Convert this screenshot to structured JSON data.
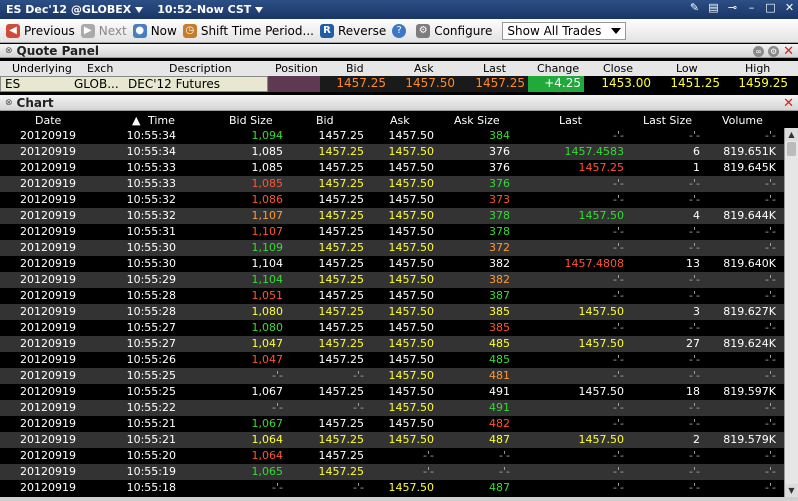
{
  "window": {
    "title_contract": "ES Dec'12 @GLOBEX",
    "title_time": "10:52-Now CST"
  },
  "toolbar": {
    "previous": "Previous",
    "next": "Next",
    "now": "Now",
    "shift": "Shift Time Period...",
    "reverse": "Reverse",
    "configure": "Configure",
    "filter_value": "Show All Trades"
  },
  "quote_panel": {
    "title": "Quote Panel",
    "headers": {
      "underlying": "Underlying",
      "exch": "Exch",
      "description": "Description",
      "position": "Position",
      "bid": "Bid",
      "ask": "Ask",
      "last": "Last",
      "change": "Change",
      "close": "Close",
      "low": "Low",
      "high": "High"
    },
    "row": {
      "underlying": "ES",
      "exch": "GLOB...",
      "description": "DEC'12 Futures",
      "position": "",
      "bid": "1457.25",
      "ask": "1457.50",
      "last": "1457.25",
      "change": "+4.25",
      "close": "1453.00",
      "low": "1451.25",
      "high": "1459.25"
    },
    "colors": {
      "change_bg": "#1faa3a",
      "position_bg": "#5e3a52",
      "value": "#ff8a22",
      "close_low_high": "#ffff33"
    }
  },
  "chart": {
    "title": "Chart",
    "headers": {
      "date": "Date",
      "time": "Time",
      "bid_size": "Bid Size",
      "bid": "Bid",
      "ask": "Ask",
      "ask_size": "Ask Size",
      "last": "Last",
      "last_size": "Last Size",
      "volume": "Volume"
    },
    "rows": [
      {
        "date": "20120919",
        "time": "10:55:34",
        "bid_size": "1,094",
        "bsc": "gn",
        "bid": "1457.25",
        "bidc": "wh",
        "ask": "1457.50",
        "askc": "wh",
        "ask_size": "384",
        "asc": "gn",
        "last": "-'-",
        "lc": "gy",
        "last_size": "-'-",
        "volume": "-'-"
      },
      {
        "date": "20120919",
        "time": "10:55:34",
        "bid_size": "1,085",
        "bsc": "wh",
        "bid": "1457.25",
        "bidc": "yl",
        "ask": "1457.50",
        "askc": "yl",
        "ask_size": "376",
        "asc": "wh",
        "last": "1457.4583",
        "lc": "gn",
        "last_size": "6",
        "volume": "819.651K"
      },
      {
        "date": "20120919",
        "time": "10:55:33",
        "bid_size": "1,085",
        "bsc": "wh",
        "bid": "1457.25",
        "bidc": "wh",
        "ask": "1457.50",
        "askc": "wh",
        "ask_size": "376",
        "asc": "wh",
        "last": "1457.25",
        "lc": "rd",
        "last_size": "1",
        "volume": "819.645K"
      },
      {
        "date": "20120919",
        "time": "10:55:33",
        "bid_size": "1,085",
        "bsc": "rd",
        "bid": "1457.25",
        "bidc": "yl",
        "ask": "1457.50",
        "askc": "yl",
        "ask_size": "376",
        "asc": "gn",
        "last": "-'-",
        "lc": "gy",
        "last_size": "-'-",
        "volume": "-'-"
      },
      {
        "date": "20120919",
        "time": "10:55:32",
        "bid_size": "1,086",
        "bsc": "rd",
        "bid": "1457.25",
        "bidc": "wh",
        "ask": "1457.50",
        "askc": "wh",
        "ask_size": "373",
        "asc": "rd",
        "last": "-'-",
        "lc": "gy",
        "last_size": "-'-",
        "volume": "-'-"
      },
      {
        "date": "20120919",
        "time": "10:55:32",
        "bid_size": "1,107",
        "bsc": "or",
        "bid": "1457.25",
        "bidc": "yl",
        "ask": "1457.50",
        "askc": "yl",
        "ask_size": "378",
        "asc": "gn",
        "last": "1457.50",
        "lc": "gn",
        "last_size": "4",
        "volume": "819.644K"
      },
      {
        "date": "20120919",
        "time": "10:55:31",
        "bid_size": "1,107",
        "bsc": "rd",
        "bid": "1457.25",
        "bidc": "wh",
        "ask": "1457.50",
        "askc": "wh",
        "ask_size": "378",
        "asc": "gn",
        "last": "-'-",
        "lc": "gy",
        "last_size": "-'-",
        "volume": "-'-"
      },
      {
        "date": "20120919",
        "time": "10:55:30",
        "bid_size": "1,109",
        "bsc": "gn",
        "bid": "1457.25",
        "bidc": "yl",
        "ask": "1457.50",
        "askc": "yl",
        "ask_size": "372",
        "asc": "or",
        "last": "-'-",
        "lc": "gy",
        "last_size": "-'-",
        "volume": "-'-"
      },
      {
        "date": "20120919",
        "time": "10:55:30",
        "bid_size": "1,104",
        "bsc": "wh",
        "bid": "1457.25",
        "bidc": "wh",
        "ask": "1457.50",
        "askc": "wh",
        "ask_size": "382",
        "asc": "wh",
        "last": "1457.4808",
        "lc": "rd",
        "last_size": "13",
        "volume": "819.640K"
      },
      {
        "date": "20120919",
        "time": "10:55:29",
        "bid_size": "1,104",
        "bsc": "gn",
        "bid": "1457.25",
        "bidc": "yl",
        "ask": "1457.50",
        "askc": "yl",
        "ask_size": "382",
        "asc": "or",
        "last": "-'-",
        "lc": "gy",
        "last_size": "-'-",
        "volume": "-'-"
      },
      {
        "date": "20120919",
        "time": "10:55:28",
        "bid_size": "1,051",
        "bsc": "rd",
        "bid": "1457.25",
        "bidc": "wh",
        "ask": "1457.50",
        "askc": "wh",
        "ask_size": "387",
        "asc": "gn",
        "last": "-'-",
        "lc": "gy",
        "last_size": "-'-",
        "volume": "-'-"
      },
      {
        "date": "20120919",
        "time": "10:55:28",
        "bid_size": "1,080",
        "bsc": "yl",
        "bid": "1457.25",
        "bidc": "yl",
        "ask": "1457.50",
        "askc": "yl",
        "ask_size": "385",
        "asc": "yl",
        "last": "1457.50",
        "lc": "yl",
        "last_size": "3",
        "volume": "819.627K"
      },
      {
        "date": "20120919",
        "time": "10:55:27",
        "bid_size": "1,080",
        "bsc": "gn",
        "bid": "1457.25",
        "bidc": "wh",
        "ask": "1457.50",
        "askc": "wh",
        "ask_size": "385",
        "asc": "rd",
        "last": "-'-",
        "lc": "gy",
        "last_size": "-'-",
        "volume": "-'-"
      },
      {
        "date": "20120919",
        "time": "10:55:27",
        "bid_size": "1,047",
        "bsc": "yl",
        "bid": "1457.25",
        "bidc": "yl",
        "ask": "1457.50",
        "askc": "yl",
        "ask_size": "485",
        "asc": "yl",
        "last": "1457.50",
        "lc": "yl",
        "last_size": "27",
        "volume": "819.624K"
      },
      {
        "date": "20120919",
        "time": "10:55:26",
        "bid_size": "1,047",
        "bsc": "rd",
        "bid": "1457.25",
        "bidc": "wh",
        "ask": "1457.50",
        "askc": "wh",
        "ask_size": "485",
        "asc": "gn",
        "last": "-'-",
        "lc": "gy",
        "last_size": "-'-",
        "volume": "-'-"
      },
      {
        "date": "20120919",
        "time": "10:55:25",
        "bid_size": "-'-",
        "bsc": "gy",
        "bid": "-'-",
        "bidc": "gy",
        "ask": "1457.50",
        "askc": "yl",
        "ask_size": "481",
        "asc": "or",
        "last": "-'-",
        "lc": "gy",
        "last_size": "-'-",
        "volume": "-'-"
      },
      {
        "date": "20120919",
        "time": "10:55:25",
        "bid_size": "1,067",
        "bsc": "wh",
        "bid": "1457.25",
        "bidc": "wh",
        "ask": "1457.50",
        "askc": "wh",
        "ask_size": "491",
        "asc": "wh",
        "last": "1457.50",
        "lc": "wh",
        "last_size": "18",
        "volume": "819.597K"
      },
      {
        "date": "20120919",
        "time": "10:55:22",
        "bid_size": "-'-",
        "bsc": "gy",
        "bid": "-'-",
        "bidc": "gy",
        "ask": "1457.50",
        "askc": "yl",
        "ask_size": "491",
        "asc": "gn",
        "last": "-'-",
        "lc": "gy",
        "last_size": "-'-",
        "volume": "-'-"
      },
      {
        "date": "20120919",
        "time": "10:55:21",
        "bid_size": "1,067",
        "bsc": "gn",
        "bid": "1457.25",
        "bidc": "wh",
        "ask": "1457.50",
        "askc": "wh",
        "ask_size": "482",
        "asc": "rd",
        "last": "-'-",
        "lc": "gy",
        "last_size": "-'-",
        "volume": "-'-"
      },
      {
        "date": "20120919",
        "time": "10:55:21",
        "bid_size": "1,064",
        "bsc": "yl",
        "bid": "1457.25",
        "bidc": "yl",
        "ask": "1457.50",
        "askc": "yl",
        "ask_size": "487",
        "asc": "yl",
        "last": "1457.50",
        "lc": "yl",
        "last_size": "2",
        "volume": "819.579K"
      },
      {
        "date": "20120919",
        "time": "10:55:20",
        "bid_size": "1,064",
        "bsc": "rd",
        "bid": "1457.25",
        "bidc": "wh",
        "ask": "-'-",
        "askc": "gy",
        "ask_size": "-'-",
        "asc": "gy",
        "last": "-'-",
        "lc": "gy",
        "last_size": "-'-",
        "volume": "-'-"
      },
      {
        "date": "20120919",
        "time": "10:55:19",
        "bid_size": "1,065",
        "bsc": "gn",
        "bid": "1457.25",
        "bidc": "yl",
        "ask": "-'-",
        "askc": "gy",
        "ask_size": "-'-",
        "asc": "gy",
        "last": "-'-",
        "lc": "gy",
        "last_size": "-'-",
        "volume": "-'-"
      },
      {
        "date": "20120919",
        "time": "10:55:18",
        "bid_size": "-'-",
        "bsc": "gy",
        "bid": "-'-",
        "bidc": "gy",
        "ask": "1457.50",
        "askc": "yl",
        "ask_size": "487",
        "asc": "gn",
        "last": "-'-",
        "lc": "gy",
        "last_size": "-'-",
        "volume": "-'-"
      }
    ]
  }
}
